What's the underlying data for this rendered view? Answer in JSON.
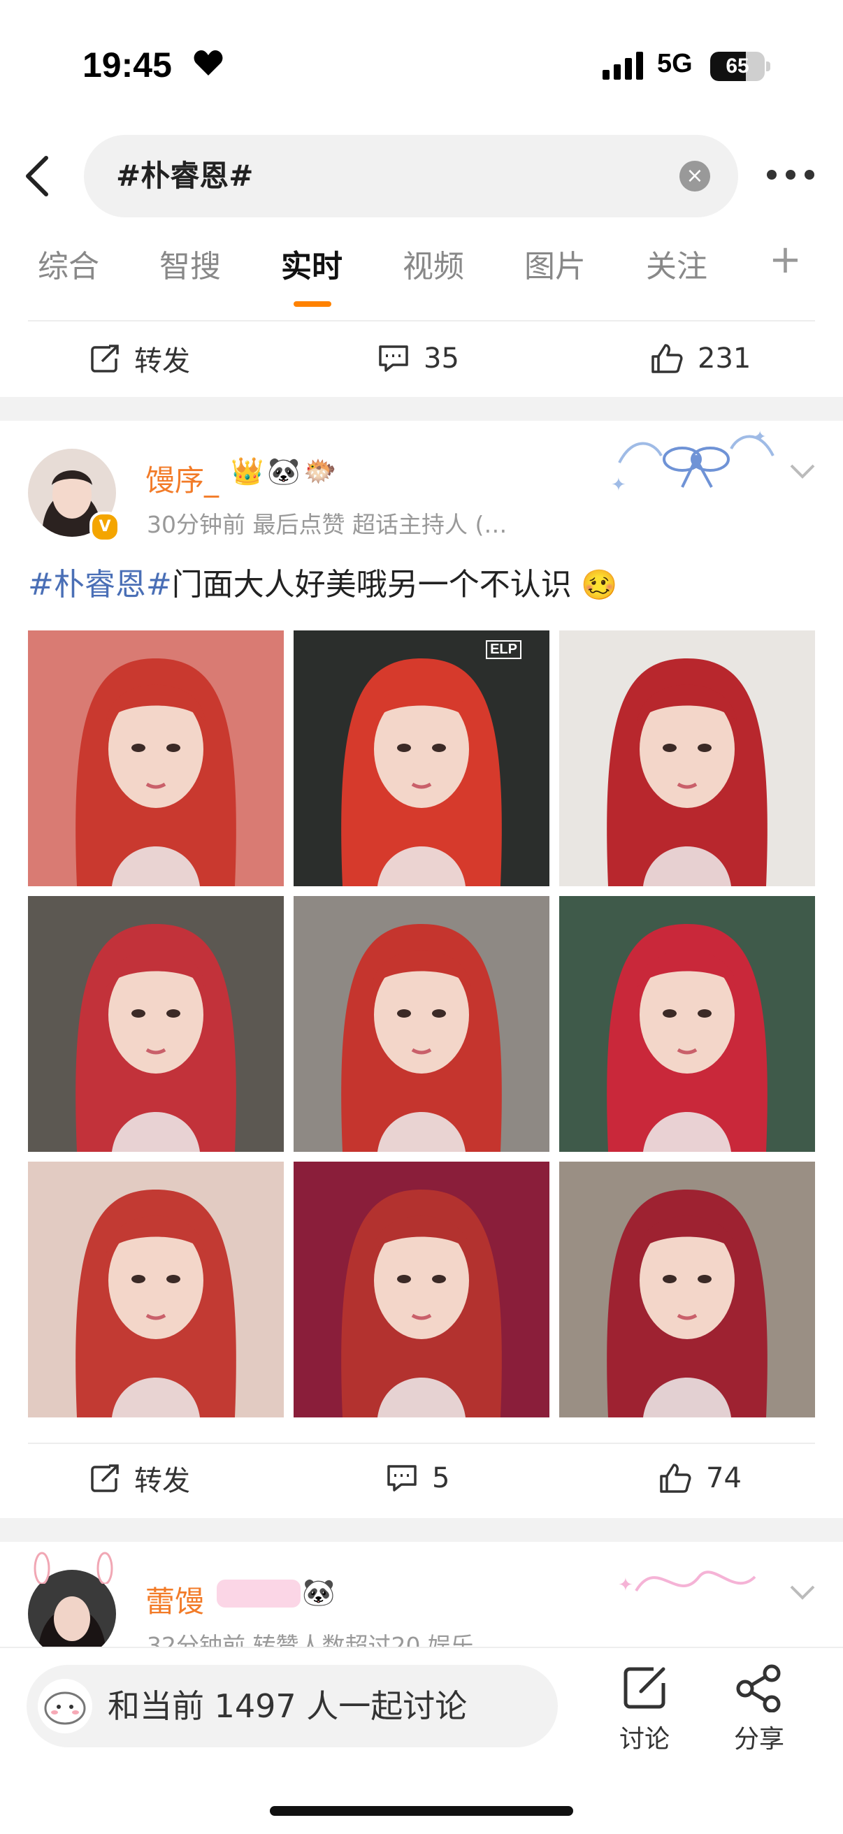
{
  "status_bar": {
    "time": "19:45",
    "network": "5G",
    "battery": "65",
    "battery_level": 0.65
  },
  "header": {
    "search_value": "#朴睿恩#"
  },
  "tabs": [
    {
      "label": "综合"
    },
    {
      "label": "智搜"
    },
    {
      "label": "实时"
    },
    {
      "label": "视频"
    },
    {
      "label": "图片"
    },
    {
      "label": "关注"
    }
  ],
  "active_tab": "实时",
  "prev_post": {
    "repost": "转发",
    "comments": "35",
    "likes": "231"
  },
  "post1": {
    "username": "馒序_",
    "meta": "30分钟前 最后点赞  超话主持人 (…",
    "tag": "#朴睿恩#",
    "text": "门面大人好美哦另一个不认识",
    "repost": "转发",
    "comments": "5",
    "likes": "74",
    "image_watermark": "ELP",
    "images": [
      {
        "bg": "#d97b73",
        "hair": "#c9392f"
      },
      {
        "bg": "#2b2e2c",
        "hair": "#d63a2c"
      },
      {
        "bg": "#e9e6e2",
        "hair": "#b8272d"
      },
      {
        "bg": "#5c5852",
        "hair": "#c2323a"
      },
      {
        "bg": "#8e8984",
        "hair": "#c5352e"
      },
      {
        "bg": "#3f5a4a",
        "hair": "#c9283a"
      },
      {
        "bg": "#e2cbc2",
        "hair": "#c23a33"
      },
      {
        "bg": "#8a1e3a",
        "hair": "#b3322f"
      },
      {
        "bg": "#9a8f84",
        "hair": "#9e2231"
      }
    ]
  },
  "post2": {
    "username": "蕾馒",
    "meta": "32分钟前 转赞人数超过20  娱乐…"
  },
  "bottom": {
    "discuss": "和当前 1497 人一起讨论",
    "discuss_btn": "讨论",
    "share_btn": "分享"
  }
}
